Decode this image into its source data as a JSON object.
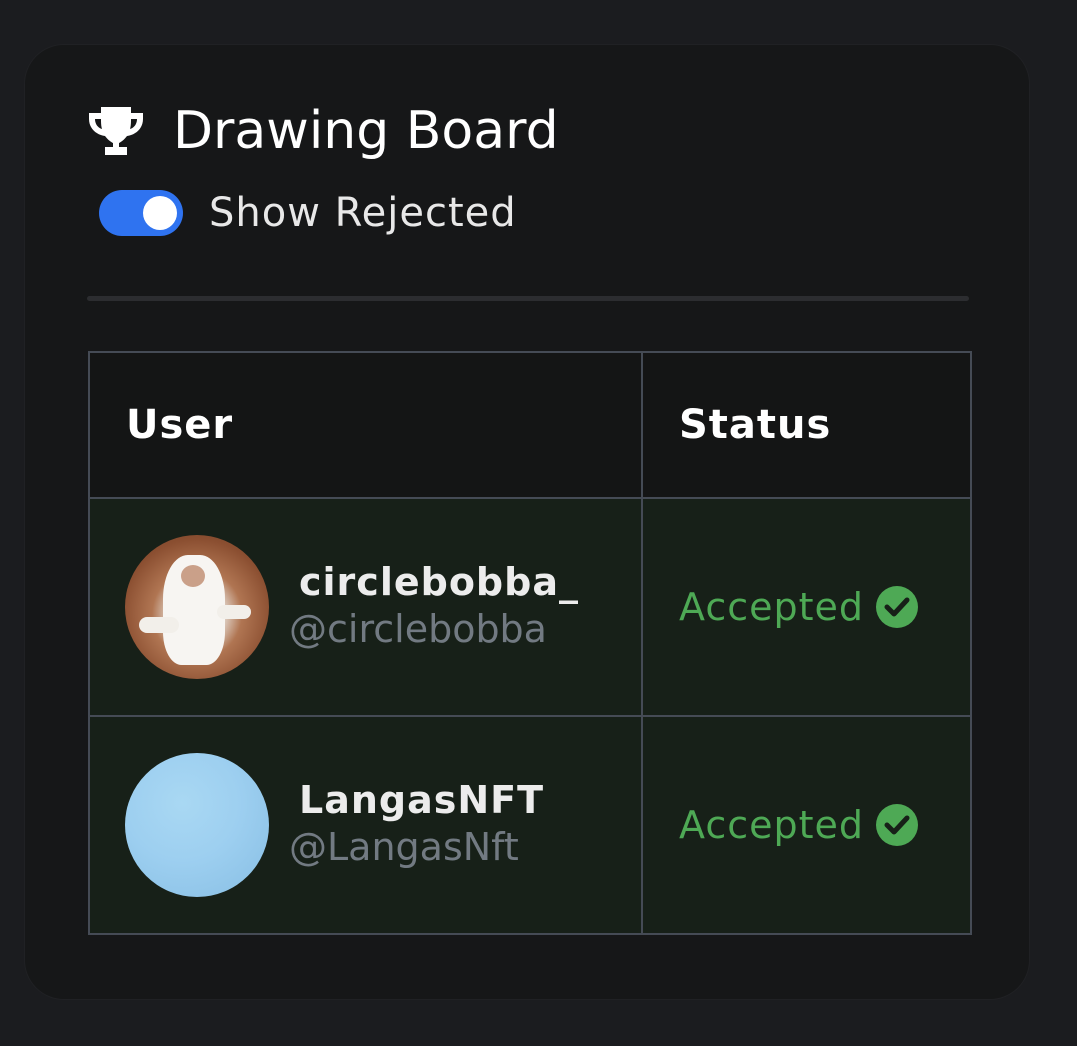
{
  "card": {
    "title": "Drawing Board",
    "title_icon": "trophy-icon"
  },
  "toggle": {
    "label": "Show Rejected",
    "checked": true,
    "accent": "#2f73f0"
  },
  "table": {
    "headers": {
      "user": "User",
      "status": "Status"
    },
    "rows": [
      {
        "display_name": "circlebobba_",
        "handle": "@circlebobba",
        "status": "Accepted",
        "status_icon": "check-circle-icon"
      },
      {
        "display_name": "LangasNFT",
        "handle": "@LangasNft",
        "status": "Accepted",
        "status_icon": "check-circle-icon"
      }
    ]
  },
  "colors": {
    "accepted": "#4ea955",
    "row_background": "#172018",
    "card_background": "#161718"
  }
}
